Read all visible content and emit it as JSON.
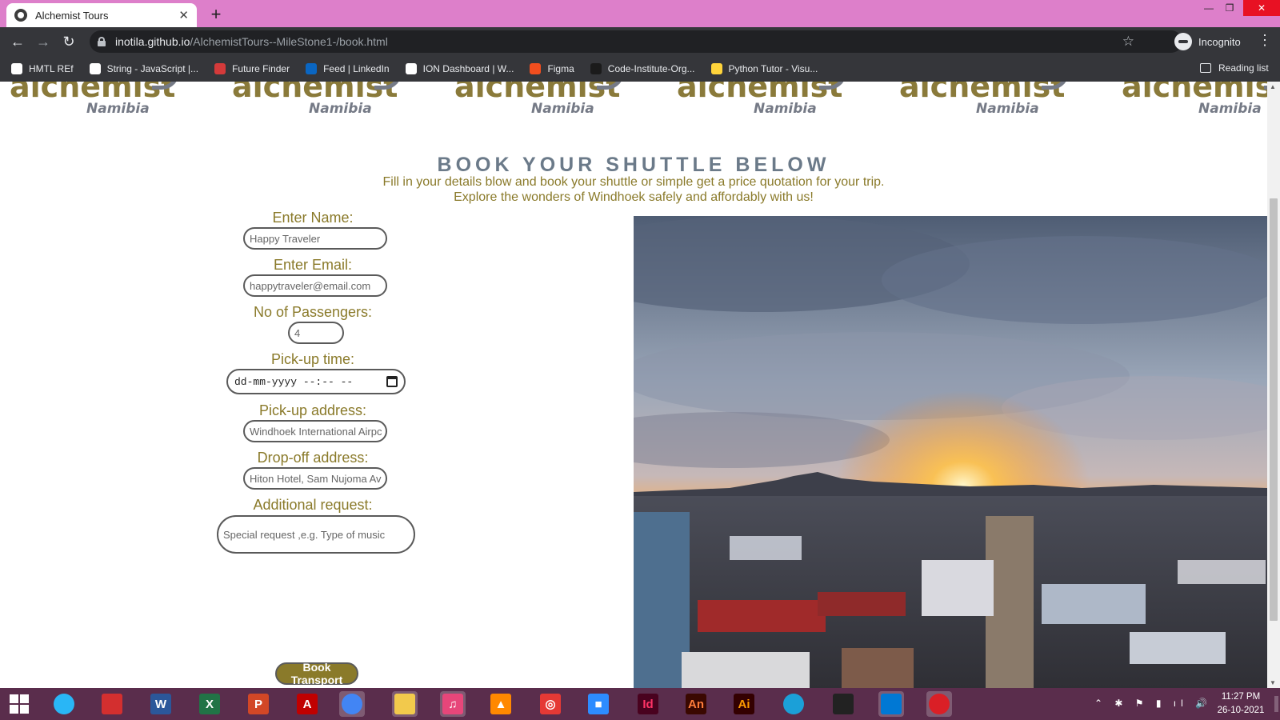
{
  "browser": {
    "tab_title": "Alchemist Tours",
    "tab_close": "✕",
    "new_tab": "+",
    "url_host": "inotila.github.io",
    "url_path": "/AlchemistTours--MileStone1-/book.html",
    "incognito_label": "Incognito",
    "reading_list_label": "Reading list",
    "window_controls": {
      "minimize": "—",
      "maximize": "❐",
      "close": "✕"
    },
    "bookmarks": [
      {
        "label": "HMTL REf",
        "icon_color": "#ffffff"
      },
      {
        "label": "String - JavaScript |...",
        "icon_color": "#ffffff"
      },
      {
        "label": "Future Finder",
        "icon_color": "#d43a3a"
      },
      {
        "label": "Feed | LinkedIn",
        "icon_color": "#0a66c2"
      },
      {
        "label": "ION Dashboard | W...",
        "icon_color": "#ffffff"
      },
      {
        "label": "Figma",
        "icon_color": "#f24e1e"
      },
      {
        "label": "Code-Institute-Org...",
        "icon_color": "#1b1b1b"
      },
      {
        "label": "Python Tutor - Visu...",
        "icon_color": "#ffd43b"
      }
    ]
  },
  "page": {
    "logo_word": "alchemist",
    "logo_sub": "Namibia",
    "heading": "BOOK YOUR SHUTTLE BELOW",
    "intro_line1": "Fill in your details blow and book your shuttle or simple get a price quotation for your trip.",
    "intro_line2": "Explore the wonders of Windhoek safely and affordably with us!",
    "form": {
      "name_label": "Enter Name:",
      "name_placeholder": "Happy Traveler",
      "email_label": "Enter Email:",
      "email_placeholder": "happytraveler@email.com",
      "passengers_label": "No of Passengers:",
      "passengers_placeholder": "4",
      "pickup_time_label": "Pick-up time:",
      "pickup_time_value": "dd-mm-yyyy --:-- --",
      "pickup_address_label": "Pick-up address:",
      "pickup_address_placeholder": "Windhoek International Airpc",
      "dropoff_address_label": "Drop-off address:",
      "dropoff_address_placeholder": "Hiton Hotel, Sam Nujoma Av",
      "request_label": "Additional request:",
      "request_placeholder": "Special request ,e.g. Type of music",
      "submit_label": "Book Transport"
    }
  },
  "taskbar": {
    "apps": [
      {
        "name": "windows-start",
        "label": "",
        "color": "#ffffff"
      },
      {
        "name": "app-blue",
        "label": "",
        "color": "#29b6f6"
      },
      {
        "name": "app-red",
        "label": "",
        "color": "#d32f2f"
      },
      {
        "name": "word",
        "label": "W",
        "color": "#2b579a"
      },
      {
        "name": "excel",
        "label": "X",
        "color": "#217346"
      },
      {
        "name": "powerpoint",
        "label": "P",
        "color": "#d24726"
      },
      {
        "name": "acrobat",
        "label": "A",
        "color": "#c00000"
      },
      {
        "name": "chrome",
        "label": "",
        "color": "#4285f4"
      },
      {
        "name": "file-explorer",
        "label": "",
        "color": "#f2c94c"
      },
      {
        "name": "itunes",
        "label": "♫",
        "color": "#e7467a"
      },
      {
        "name": "vlc",
        "label": "▲",
        "color": "#ff8800"
      },
      {
        "name": "app-target",
        "label": "◎",
        "color": "#e53935"
      },
      {
        "name": "zoom",
        "label": "■",
        "color": "#2d8cff"
      },
      {
        "name": "indesign",
        "label": "Id",
        "color": "#49021f"
      },
      {
        "name": "animate",
        "label": "An",
        "color": "#3a0800"
      },
      {
        "name": "illustrator",
        "label": "Ai",
        "color": "#330000"
      },
      {
        "name": "edge",
        "label": "",
        "color": "#1ba0d8"
      },
      {
        "name": "app-dark",
        "label": "",
        "color": "#222222"
      },
      {
        "name": "vscode",
        "label": "",
        "color": "#0078d4"
      },
      {
        "name": "creative-cloud",
        "label": "",
        "color": "#da1f26"
      }
    ],
    "tray_icons": "⌃ ✱ ⚑ ▮ ıl 🔊",
    "time": "11:27 PM",
    "date": "26-10-2021"
  }
}
